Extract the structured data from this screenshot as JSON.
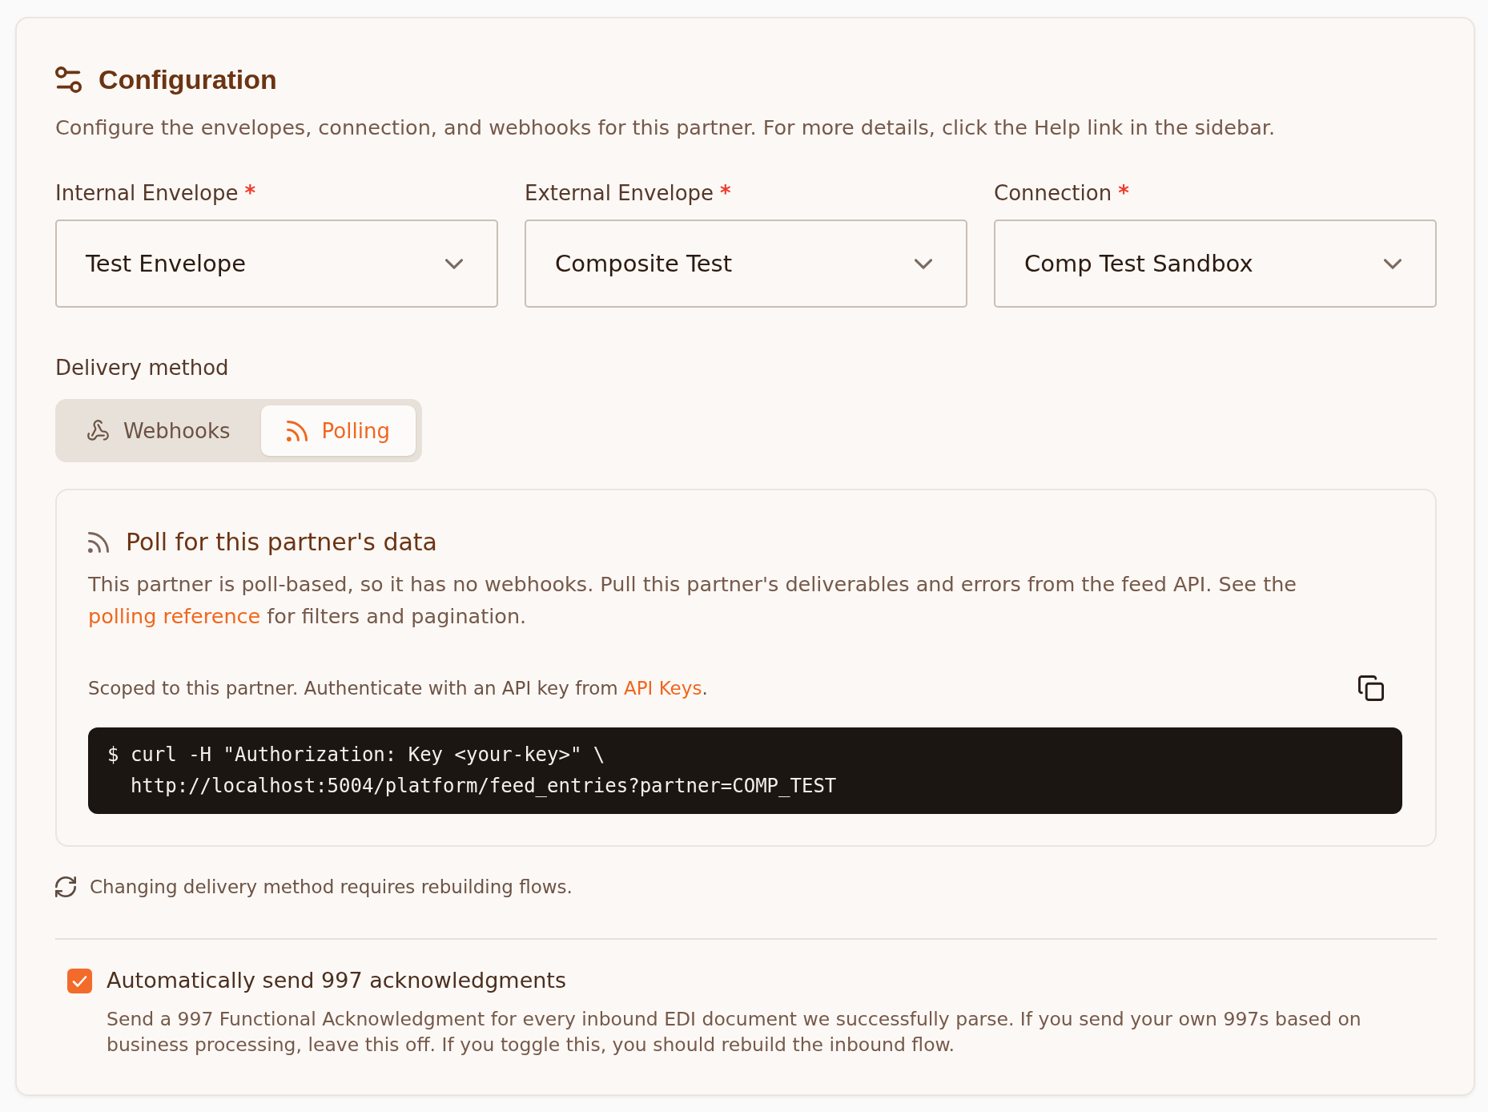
{
  "header": {
    "title": "Configuration",
    "description": "Configure the envelopes, connection, and webhooks for this partner. For more details, click the Help link in the sidebar."
  },
  "fields": [
    {
      "label": "Internal Envelope",
      "required_mark": "*",
      "value": "Test Envelope"
    },
    {
      "label": "External Envelope",
      "required_mark": "*",
      "value": "Composite Test"
    },
    {
      "label": "Connection",
      "required_mark": "*",
      "value": "Comp Test Sandbox"
    }
  ],
  "delivery_method": {
    "label": "Delivery method",
    "options": [
      {
        "kind": "webhooks",
        "label": "Webhooks",
        "selected": false
      },
      {
        "kind": "polling",
        "label": "Polling",
        "selected": true
      }
    ]
  },
  "polling_panel": {
    "title": "Poll for this partner's data",
    "description": {
      "text": "This partner is poll-based, so it has no webhooks. Pull this partner's deliverables and errors from the feed API. See the ",
      "link": "polling reference",
      "text_after": " for filters and pagination."
    },
    "auth_note": {
      "text": "Scoped to this partner. Authenticate with an API key from ",
      "link": "API Keys",
      "text_after": "."
    },
    "code_lines": [
      "$ curl -H \"Authorization: Key <your-key>\" \\",
      "  http://localhost:5004/platform/feed_entries?partner=COMP_TEST"
    ]
  },
  "notice": "Changing delivery method requires rebuilding flows.",
  "acknowledgments": {
    "checked": true,
    "label": "Automatically send 997 acknowledgments",
    "description": "Send a 997 Functional Acknowledgment for every inbound EDI document we successfully parse. If you send your own 997s based on business processing, leave this off. If you toggle this, you should rebuild the inbound flow."
  }
}
